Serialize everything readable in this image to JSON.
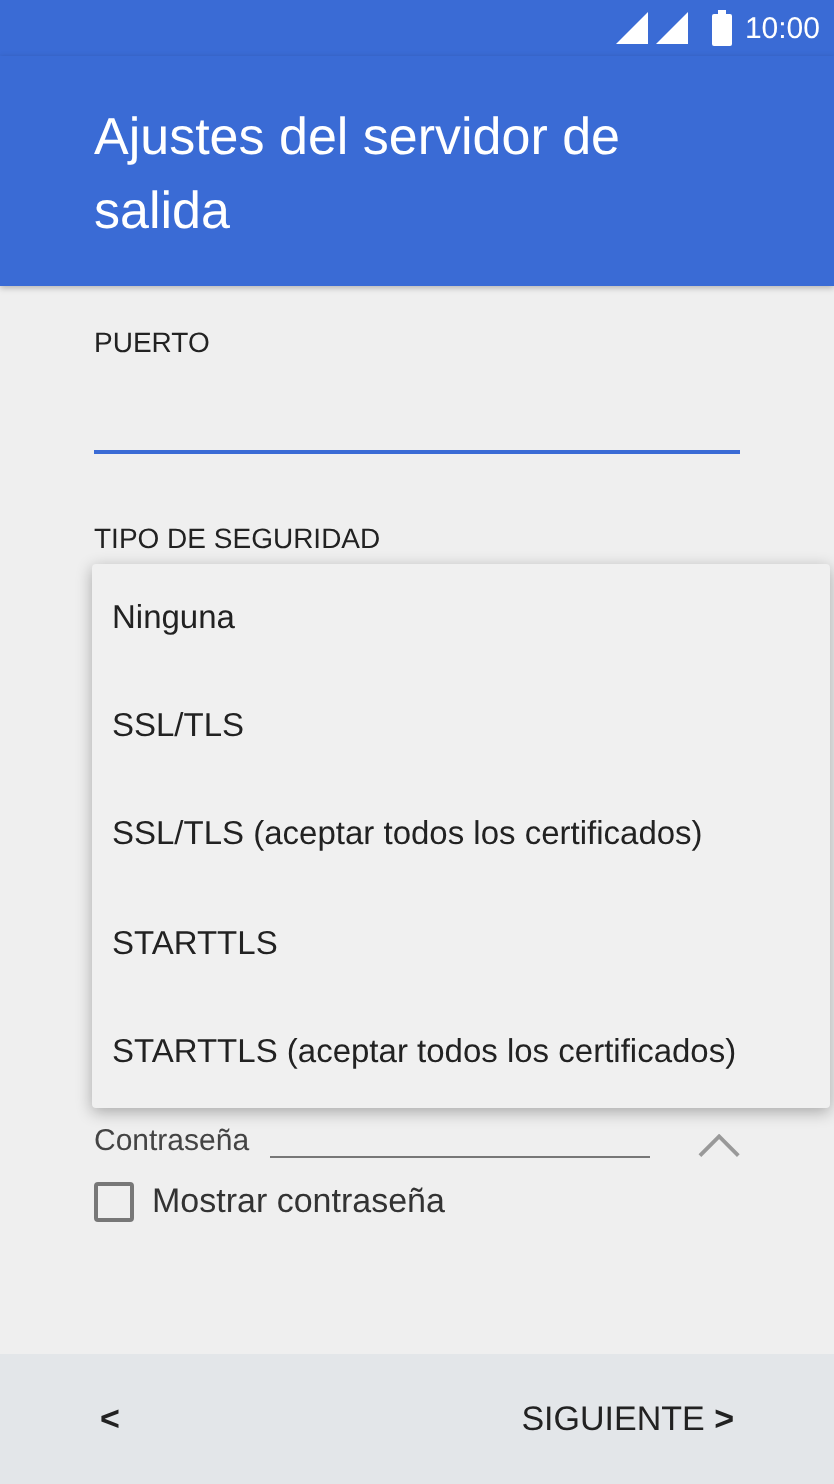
{
  "status_bar": {
    "time": "10:00"
  },
  "header": {
    "title": "Ajustes del servidor de salida"
  },
  "port_field": {
    "label": "PUERTO"
  },
  "security": {
    "label": "TIPO DE SEGURIDAD",
    "menu": [
      {
        "label": "Ninguna"
      },
      {
        "label": "SSL/TLS"
      },
      {
        "label": "SSL/TLS (aceptar todos los certificados)"
      },
      {
        "label": "STARTTLS"
      },
      {
        "label": "STARTTLS (aceptar todos los certificados)"
      }
    ]
  },
  "password_field": {
    "label": "Contraseña"
  },
  "show_password": {
    "label": "Mostrar contraseña",
    "checked": false
  },
  "nav": {
    "back": "<",
    "next": "SIGUIENTE",
    "next_icon": ">"
  }
}
